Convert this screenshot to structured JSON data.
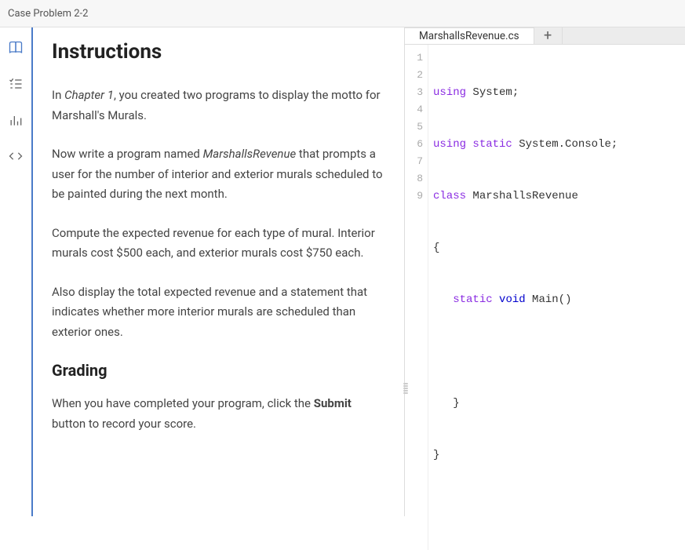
{
  "header": {
    "title": "Case Problem 2-2"
  },
  "sidebar": {
    "items": [
      {
        "name": "book-icon",
        "active": true
      },
      {
        "name": "checklist-icon",
        "active": false
      },
      {
        "name": "chart-icon",
        "active": false
      },
      {
        "name": "code-icon",
        "active": false
      }
    ]
  },
  "instructions": {
    "heading": "Instructions",
    "p1_pre": "In ",
    "p1_italic": "Chapter 1",
    "p1_post": ", you created two programs to display the motto for Marshall's Murals.",
    "p2_pre": "Now write a program named ",
    "p2_italic": "MarshallsRevenue",
    "p2_post": " that prompts a user for the number of interior and exterior murals scheduled to be painted during the next month.",
    "p3": "Compute the expected revenue for each type of mural. Interior murals cost $500 each, and exterior murals cost $750 each.",
    "p4": "Also display the total expected revenue and a statement that indicates whether more interior murals are scheduled than exterior ones.",
    "grading_heading": "Grading",
    "p5_pre": "When you have completed your program, click the ",
    "p5_bold": "Submit",
    "p5_post": " button to record your score."
  },
  "editor": {
    "tab_label": "MarshallsRevenue.cs",
    "add_tab_label": "+",
    "gutter": [
      "1",
      "2",
      "3",
      "4",
      "5",
      "6",
      "7",
      "8",
      "9"
    ],
    "code": {
      "l1": {
        "kw": "using",
        "rest": " System;"
      },
      "l2": {
        "kw": "using",
        "kw2": " static",
        "rest": " System.Console;"
      },
      "l3": {
        "kw": "class",
        "rest": " MarshallsRevenue"
      },
      "l4": {
        "text": "{"
      },
      "l5": {
        "indent": "   ",
        "kw": "static",
        "kw2": " void",
        "rest": " Main()"
      },
      "l6": {
        "text": ""
      },
      "l7": {
        "text": "   }"
      },
      "l8": {
        "text": "}"
      },
      "l9": {
        "text": ""
      }
    }
  }
}
